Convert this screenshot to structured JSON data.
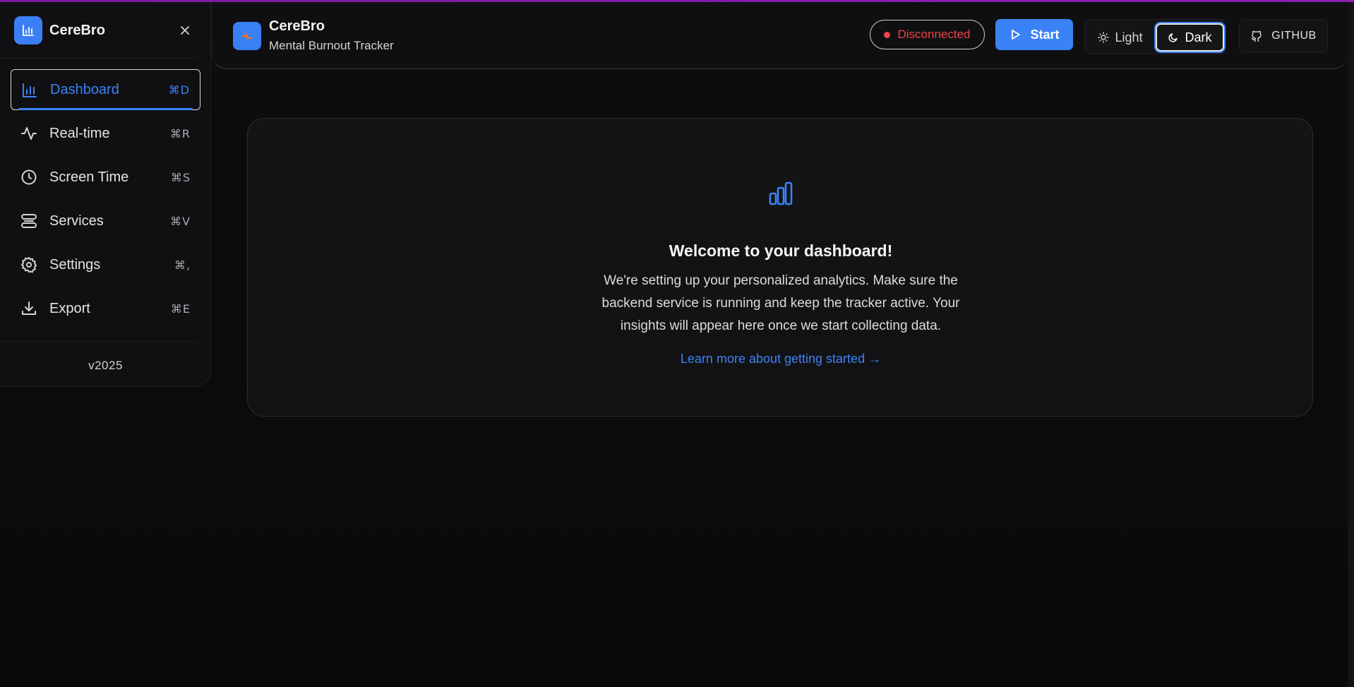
{
  "sidebar": {
    "brand_name": "CereBro",
    "items": [
      {
        "label": "Dashboard",
        "shortcut": "⌘D",
        "icon": "bar-chart-icon",
        "active": true
      },
      {
        "label": "Real-time",
        "shortcut": "⌘R",
        "icon": "activity-icon",
        "active": false
      },
      {
        "label": "Screen Time",
        "shortcut": "⌘S",
        "icon": "clock-icon",
        "active": false
      },
      {
        "label": "Services",
        "shortcut": "⌘V",
        "icon": "server-icon",
        "active": false
      },
      {
        "label": "Settings",
        "shortcut": "⌘,",
        "icon": "gear-icon",
        "active": false
      },
      {
        "label": "Export",
        "shortcut": "⌘E",
        "icon": "download-icon",
        "active": false
      }
    ],
    "version": "v2025"
  },
  "header": {
    "title": "CereBro",
    "subtitle": "Mental Burnout Tracker",
    "status": "Disconnected",
    "start_label": "Start",
    "theme_light_label": "Light",
    "theme_dark_label": "Dark",
    "theme_selected": "Dark",
    "github_label": "GITHUB"
  },
  "main": {
    "title": "Welcome to your dashboard!",
    "body": "We're setting up your personalized analytics. Make sure the backend service is running and keep the tracker active. Your insights will appear here once we start collecting data.",
    "link": "Learn more about getting started →"
  },
  "colors": {
    "accent": "#3b82f6",
    "status_disconnected": "#ef4444",
    "top_bar": "#7a1aa0"
  }
}
